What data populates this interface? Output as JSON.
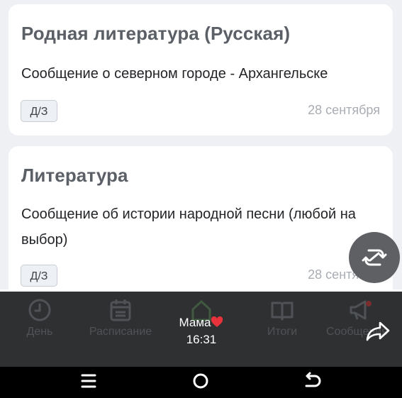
{
  "cards": [
    {
      "title": "Родная литература (Русская)",
      "text": "Сообщение о северном городе - Архангельске",
      "badge": "Д/З",
      "date": "28 сентября"
    },
    {
      "title": "Литература",
      "text": "Сообщение об истории народной песни (любой на выбор)",
      "badge": "Д/З",
      "date": "28 сентября"
    }
  ],
  "tabs": [
    {
      "label": "День",
      "icon": "clock-icon"
    },
    {
      "label": "Расписание",
      "icon": "calendar-icon"
    },
    {
      "label": "",
      "icon": "home-icon"
    },
    {
      "label": "Итоги",
      "icon": "book-icon"
    },
    {
      "label": "Сообщения",
      "icon": "megaphone-icon"
    }
  ],
  "notification": {
    "name": "Мама",
    "time": "16:31"
  },
  "system_nav": {
    "recents": "recents-icon",
    "home": "home-circle-icon",
    "back": "back-icon"
  },
  "colors": {
    "background": "#eef0f3",
    "card": "#ffffff",
    "panel": "#2f3032",
    "heart": "#e8323c"
  }
}
